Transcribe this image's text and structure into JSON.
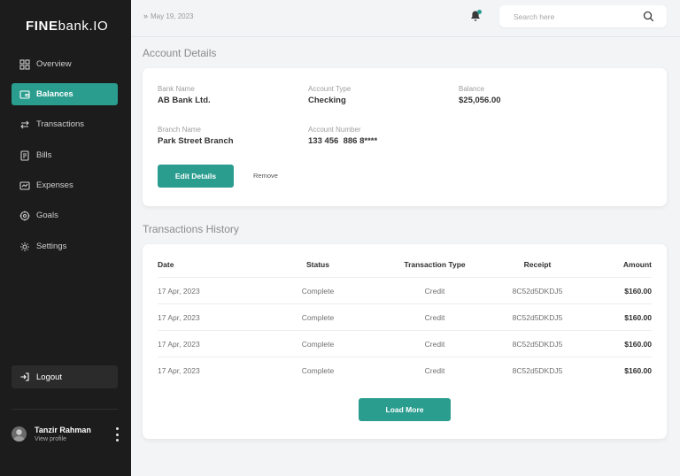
{
  "brand": {
    "bold": "FINE",
    "rest": "bank.IO"
  },
  "sidebar": {
    "items": [
      {
        "label": "Overview",
        "icon": "grid-icon",
        "active": false
      },
      {
        "label": "Balances",
        "icon": "wallet-icon",
        "active": true
      },
      {
        "label": "Transactions",
        "icon": "swap-arrows-icon",
        "active": false
      },
      {
        "label": "Bills",
        "icon": "bill-icon",
        "active": false
      },
      {
        "label": "Expenses",
        "icon": "expenses-icon",
        "active": false
      },
      {
        "label": "Goals",
        "icon": "target-icon",
        "active": false
      },
      {
        "label": "Settings",
        "icon": "gear-icon",
        "active": false
      }
    ],
    "logout": "Logout",
    "user": {
      "name": "Tanzir Rahman",
      "sub": "View profile"
    }
  },
  "header": {
    "date": "May 19, 2023",
    "search_placeholder": "Search here"
  },
  "account": {
    "title": "Account Details",
    "bank_name_label": "Bank Name",
    "bank_name": "AB Bank Ltd.",
    "account_type_label": "Account Type",
    "account_type": "Checking",
    "balance_label": "Balance",
    "balance": "$25,056.00",
    "branch_name_label": "Branch Name",
    "branch_name": "Park Street Branch",
    "account_number_label": "Account Number",
    "account_number": "133 456  886 8****",
    "edit_label": "Edit Details",
    "remove_label": "Remove"
  },
  "transactions": {
    "title": "Transactions History",
    "columns": [
      "Date",
      "Status",
      "Transaction Type",
      "Receipt",
      "Amount"
    ],
    "rows": [
      [
        "17 Apr, 2023",
        "Complete",
        "Credit",
        "8C52d5DKDJ5",
        "$160.00"
      ],
      [
        "17 Apr, 2023",
        "Complete",
        "Credit",
        "8C52d5DKDJ5",
        "$160.00"
      ],
      [
        "17 Apr, 2023",
        "Complete",
        "Credit",
        "8C52d5DKDJ5",
        "$160.00"
      ],
      [
        "17 Apr, 2023",
        "Complete",
        "Credit",
        "8C52d5DKDJ5",
        "$160.00"
      ]
    ],
    "load_more": "Load More"
  },
  "colors": {
    "accent": "#2a9d8f",
    "sidebar": "#1c1c1c",
    "background": "#f3f4f6"
  }
}
